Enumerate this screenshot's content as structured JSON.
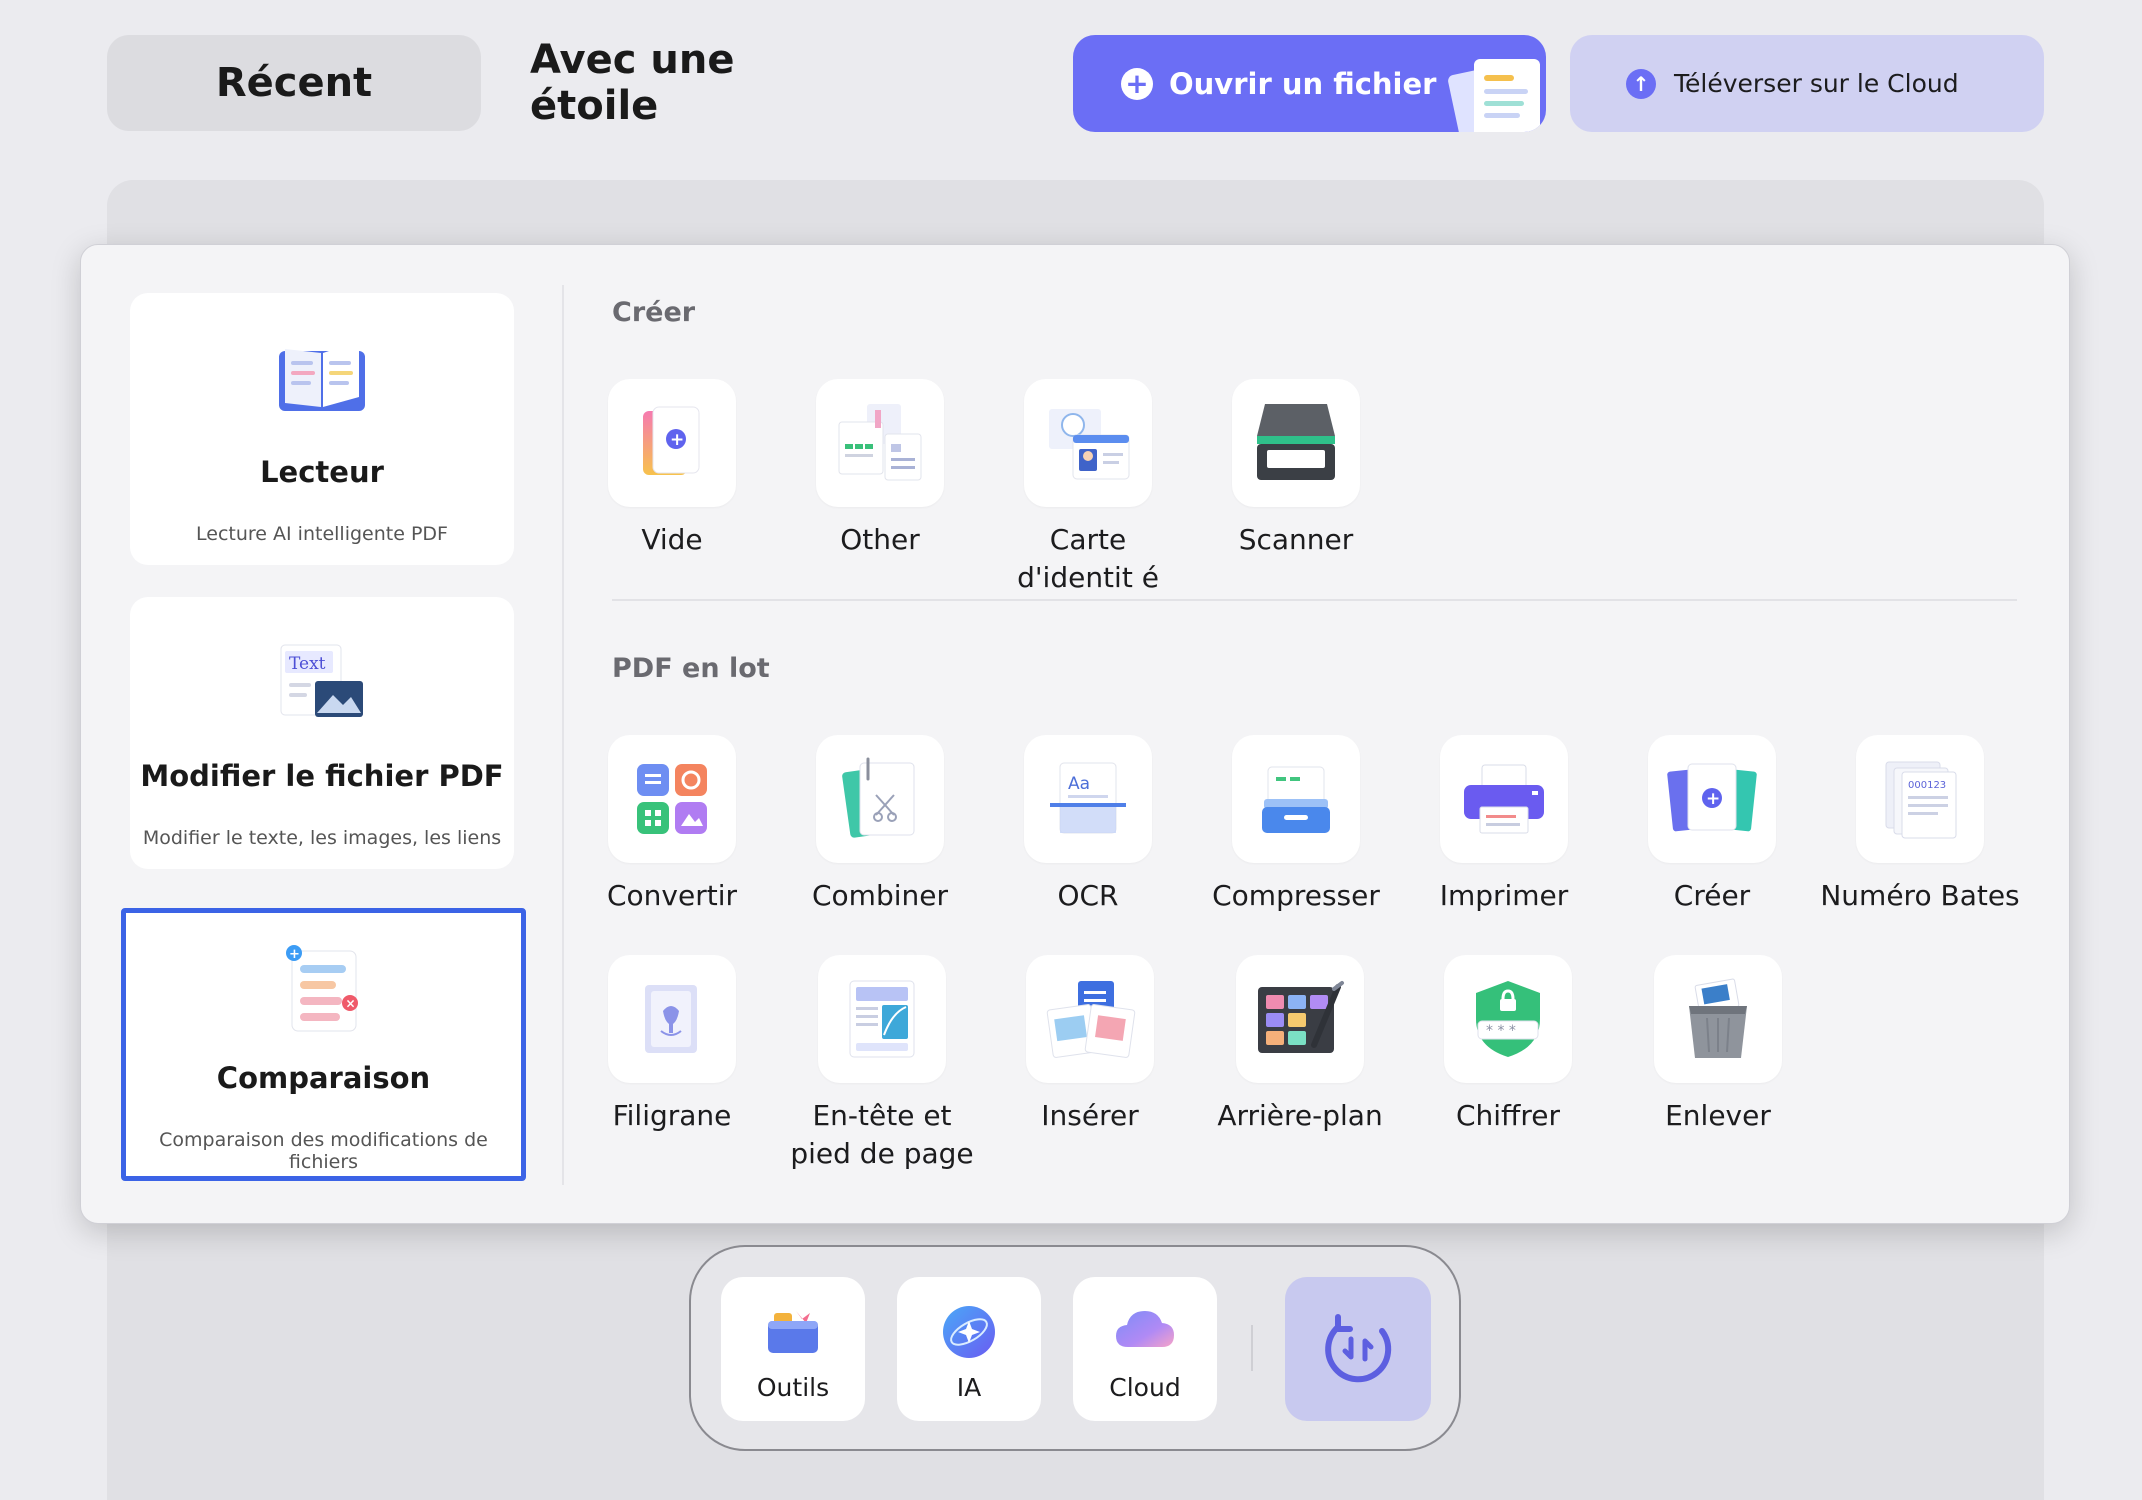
{
  "tabs": {
    "recent": "Récent",
    "starred": "Avec une étoile"
  },
  "actions": {
    "open_file": "Ouvrir un fichier",
    "upload_cloud": "Téléverser sur le Cloud"
  },
  "sidebar": {
    "cards": [
      {
        "title": "Lecteur",
        "subtitle": "Lecture AI intelligente PDF",
        "icon": "book-icon"
      },
      {
        "title": "Modifier le fichier PDF",
        "subtitle": "Modifier le texte, les images, les liens",
        "icon": "edit-text-image-icon",
        "icon_text": "Text"
      },
      {
        "title": "Comparaison",
        "subtitle": "Comparaison des modifications de fichiers",
        "icon": "compare-doc-icon",
        "selected": true
      }
    ]
  },
  "create": {
    "title": "Créer",
    "items": [
      {
        "label": "Vide",
        "icon": "blank-doc-icon"
      },
      {
        "label": "Other",
        "icon": "other-docs-icon"
      },
      {
        "label": "Carte d'identit é",
        "icon": "id-card-icon"
      },
      {
        "label": "Scanner",
        "icon": "scanner-icon"
      }
    ]
  },
  "batch": {
    "title": "PDF en lot",
    "row1": [
      {
        "label": "Convertir",
        "icon": "convert-icon"
      },
      {
        "label": "Combiner",
        "icon": "combine-icon"
      },
      {
        "label": "OCR",
        "icon": "ocr-icon"
      },
      {
        "label": "Compresser",
        "icon": "compress-icon"
      },
      {
        "label": "Imprimer",
        "icon": "printer-icon"
      },
      {
        "label": "Créer",
        "icon": "create-icon"
      },
      {
        "label": "Numéro Bates",
        "icon": "bates-number-icon"
      }
    ],
    "row2": [
      {
        "label": "Filigrane",
        "icon": "watermark-icon"
      },
      {
        "label": "En-tête et pied de page",
        "icon": "header-footer-icon"
      },
      {
        "label": "Insérer",
        "icon": "insert-icon"
      },
      {
        "label": "Arrière-plan",
        "icon": "background-icon"
      },
      {
        "label": "Chiffrer",
        "icon": "encrypt-icon"
      },
      {
        "label": "Enlever",
        "icon": "trash-icon"
      }
    ]
  },
  "dock": {
    "items": [
      {
        "label": "Outils",
        "icon": "toolbox-icon"
      },
      {
        "label": "IA",
        "icon": "ai-icon"
      },
      {
        "label": "Cloud",
        "icon": "cloud-icon"
      }
    ],
    "sync_icon": "sync-icon"
  },
  "colors": {
    "accent": "#6b6ef5",
    "selected_border": "#3b63e6",
    "cloud_button": "#d0d1f2"
  }
}
